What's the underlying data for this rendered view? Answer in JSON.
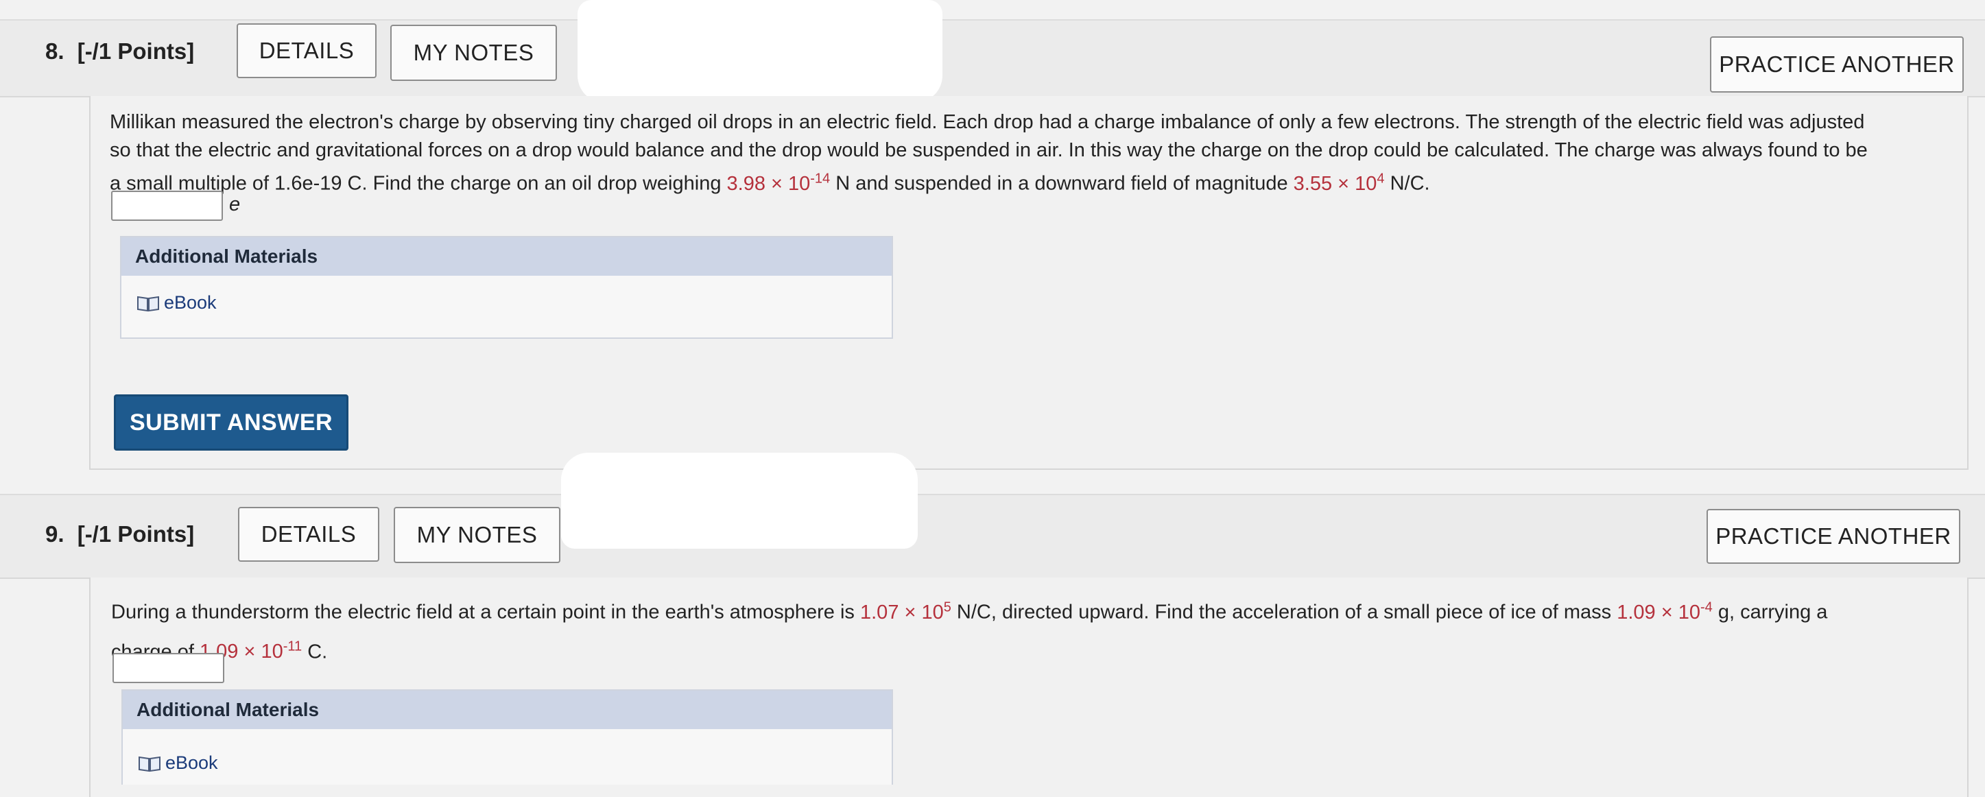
{
  "q8": {
    "number": "8.",
    "points": "[-/1 Points]",
    "details_label": "DETAILS",
    "notes_label": "MY NOTES",
    "practice_label": "PRACTICE ANOTHER",
    "text_line1": "Millikan measured the electron's charge by observing tiny charged oil drops in an electric field. Each drop had a charge imbalance of only a few electrons. The strength of the electric field was adjusted",
    "text_line2": "so that the electric and gravitational forces on a drop would balance and the drop would be suspended in air. In this way the charge on the drop could be calculated. The charge was always found to be",
    "text_line3_a": "a small multiple of 1.6e-19 C. Find the charge on an oil drop weighing ",
    "weight_mantissa": "3.98 × 10",
    "weight_exp": "-14",
    "text_line3_b": " N and suspended in a downward field of magnitude ",
    "field_mantissa": "3.55 × 10",
    "field_exp": "4",
    "text_line3_c": " N/C.",
    "answer_value": "",
    "answer_unit": "e",
    "additional_materials": "Additional Materials",
    "ebook_label": "eBook",
    "submit_label": "SUBMIT ANSWER"
  },
  "q9": {
    "number": "9.",
    "points": "[-/1 Points]",
    "details_label": "DETAILS",
    "notes_label": "MY NOTES",
    "practice_label": "PRACTICE ANOTHER",
    "text_line1_a": "During a thunderstorm the electric field at a certain point in the earth's atmosphere is ",
    "field_mantissa": "1.07 × 10",
    "field_exp": "5",
    "text_line1_b": " N/C, directed upward. Find the acceleration of a small piece of ice of mass ",
    "mass_mantissa": "1.09 × 10",
    "mass_exp": "-4",
    "text_line1_c": " g, carrying a",
    "text_line2_a": "charge of ",
    "charge_mantissa": "1.09 × 10",
    "charge_exp": "-11",
    "text_line2_b": " C.",
    "answer_value": "",
    "additional_materials": "Additional Materials",
    "ebook_label": "eBook"
  },
  "colors": {
    "value_red": "#b5313c",
    "submit_blue": "#1e5a8e",
    "materials_header": "#cdd5e6",
    "ebook_link": "#1b3b7a"
  }
}
